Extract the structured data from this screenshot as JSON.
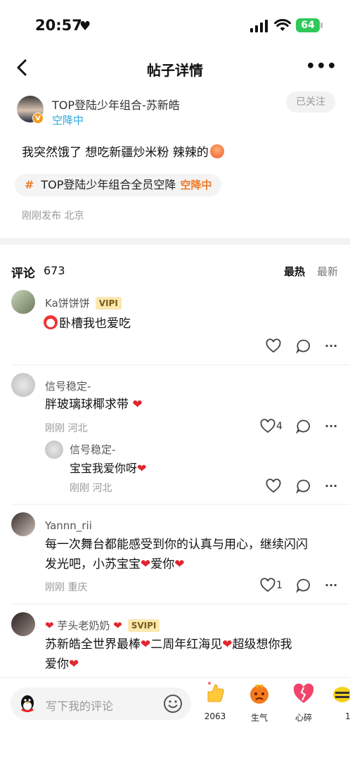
{
  "status": {
    "time": "20:57",
    "battery": "64"
  },
  "nav": {
    "title": "帖子详情"
  },
  "post": {
    "author": "TOP登陆少年组合-苏新皓",
    "status": "空降中",
    "follow": "已关注",
    "text": "我突然饿了 想吃新疆炒米粉 辣辣的",
    "topic": "TOP登陆少年组合全员空降",
    "topic_badge": "空降中",
    "meta": "刚刚发布 北京"
  },
  "comments_header": {
    "title": "评论",
    "count": "673",
    "sort_hot": "最热",
    "sort_new": "最新"
  },
  "comments": [
    {
      "name": "Ka饼饼饼",
      "vip": "VIPI",
      "text": "卧槽我也爱吃"
    },
    {
      "name": "信号稳定-",
      "text": "胖玻璃球椰求带",
      "meta": "刚刚 河北",
      "likes": "4",
      "reply": {
        "name": "信号稳定-",
        "text": "宝宝我爱你呀",
        "meta": "刚刚 河北"
      }
    },
    {
      "name": "Yannn_rii",
      "text_line1": "每一次舞台都能感受到你的认真与用心，继续闪闪",
      "text_line2a": "发光吧，小苏宝宝",
      "text_line2b": "爱你",
      "meta": "刚刚 重庆",
      "likes": "1"
    },
    {
      "name": "芋头老奶奶",
      "vip": "SVIPI",
      "text_line1a": "苏新皓全世界最棒",
      "text_line1b": "二周年红海见",
      "text_line1c": "超级想你我",
      "text_line2": "爱你"
    }
  ],
  "bottom": {
    "placeholder": "写下我的评论",
    "reactions": [
      {
        "label": "2063",
        "icon": "thumbs-up-icon"
      },
      {
        "label": "生气",
        "icon": "angry-face-icon"
      },
      {
        "label": "心碎",
        "icon": "broken-heart-icon"
      },
      {
        "label": "1",
        "icon": "bee-icon"
      }
    ]
  }
}
